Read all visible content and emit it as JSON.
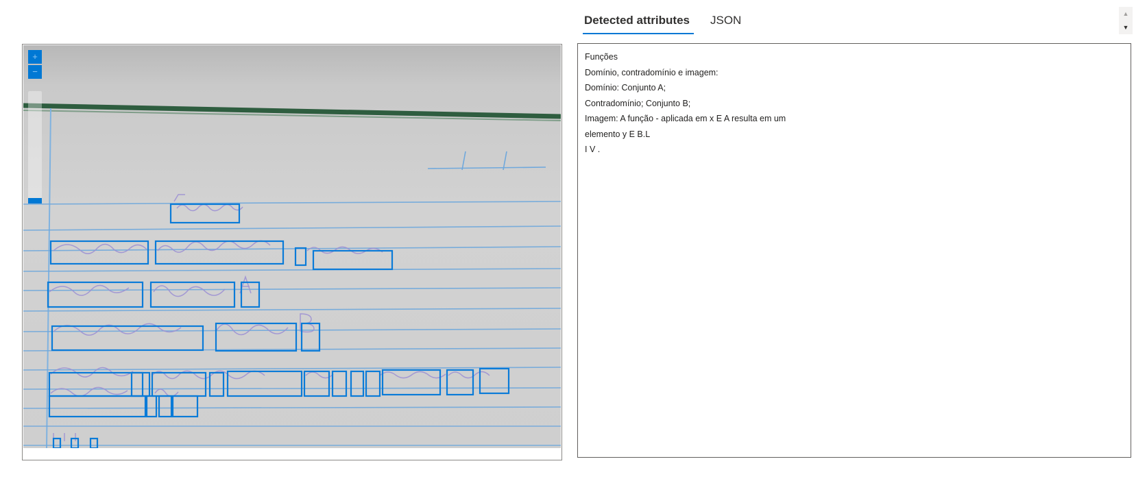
{
  "viewer": {
    "zoom_in_label": "+",
    "zoom_out_label": "−"
  },
  "tabs": [
    {
      "label": "Detected attributes",
      "active": true
    },
    {
      "label": "JSON",
      "active": false
    }
  ],
  "spinner": {
    "up_glyph": "▲",
    "down_glyph": "▼"
  },
  "results": {
    "lines": [
      "Funções",
      "Domínio, contradomínio e imagem:",
      "Domínio: Conjunto A;",
      "Contradomínio; Conjunto B;",
      "Imagem: A função - aplicada em x E A resulta em um",
      "elemento y E B.L",
      "I V ."
    ]
  },
  "colors": {
    "accent": "#0078d4",
    "detection_box": "#0a7bd8",
    "notebook_rule": "#6fa8dc",
    "notebook_margin": "#2e7d4f",
    "handwriting": "#8b7fc9"
  }
}
